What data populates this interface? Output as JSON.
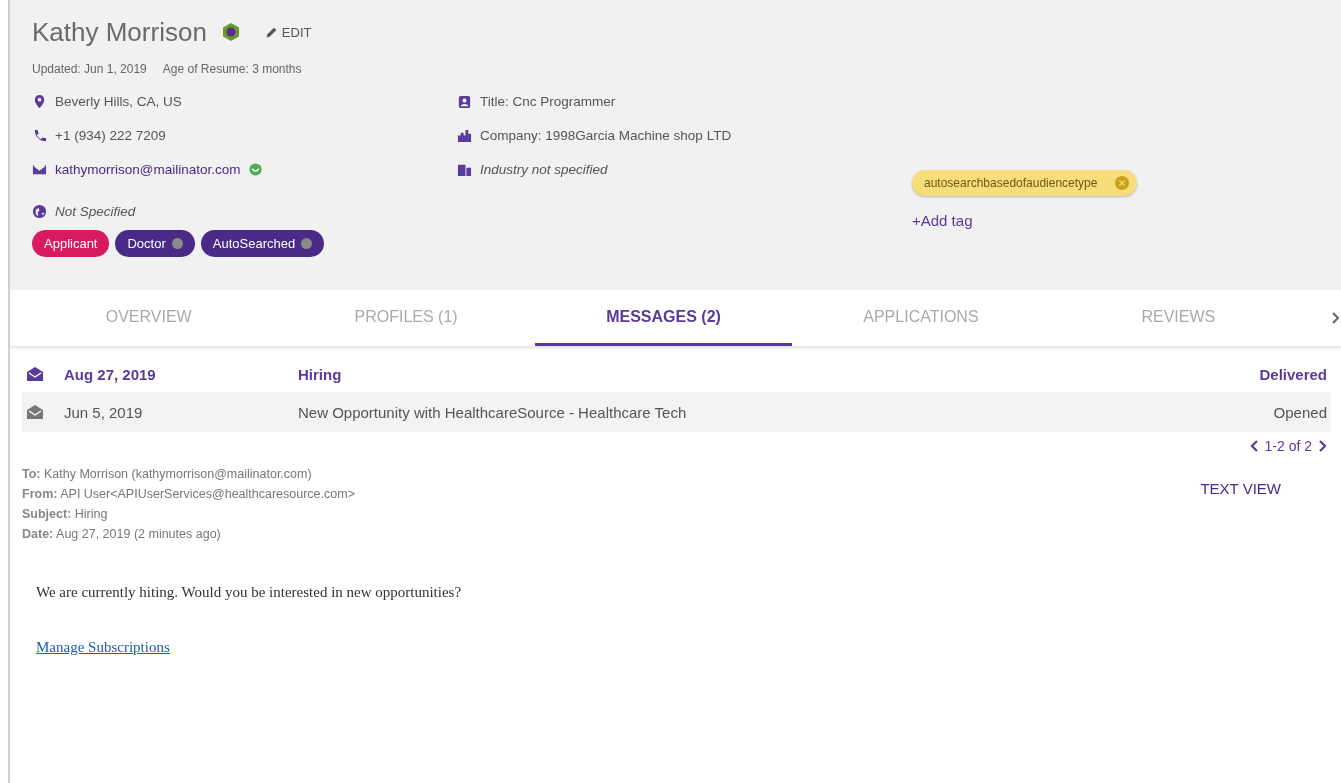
{
  "profile": {
    "name": "Kathy Morrison",
    "edit": "EDIT",
    "updated": "Updated: Jun 1, 2019",
    "resume_age": "Age of Resume: 3 months",
    "contacts": [
      {
        "kind": "location",
        "text": "Beverly Hills, CA, US",
        "italic": false
      },
      {
        "kind": "phone",
        "text": "+1 (934) 222 7209",
        "italic": false
      },
      {
        "kind": "email",
        "text": "kathymorrison@mailinator.com",
        "italic": false,
        "verified": true
      },
      {
        "kind": "web",
        "text": "Not Specified",
        "italic": true
      }
    ],
    "job": [
      {
        "kind": "title",
        "text": "Title: Cnc Programmer",
        "italic": false
      },
      {
        "kind": "company",
        "text": "Company: 1998Garcia Machine shop LTD",
        "italic": false
      },
      {
        "kind": "industry",
        "text": "Industry not specified",
        "italic": true
      }
    ],
    "roles": [
      {
        "label": "Applicant",
        "color": "#d81b60",
        "removable": false
      },
      {
        "label": "Doctor",
        "color": "#4a2a87",
        "removable": true
      },
      {
        "label": "AutoSearched",
        "color": "#4a2a87",
        "removable": true
      }
    ],
    "tags": [
      {
        "label": "autosearchbasedofaudiencetype",
        "color": "#f7dd7c"
      }
    ],
    "add_tag": "+Add tag"
  },
  "tabs": [
    {
      "label": "OVERVIEW",
      "selected": false
    },
    {
      "label": "PROFILES (1)",
      "selected": false
    },
    {
      "label": "MESSAGES (2)",
      "selected": true
    },
    {
      "label": "APPLICATIONS",
      "selected": false
    },
    {
      "label": "REVIEWS",
      "selected": false
    }
  ],
  "messages": [
    {
      "date": "Aug 27, 2019",
      "subject": "Hiring",
      "status": "Delivered",
      "selected": true
    },
    {
      "date": "Jun 5, 2019",
      "subject": "New Opportunity with HealthcareSource - Healthcare Tech",
      "status": "Opened",
      "selected": false
    }
  ],
  "pager": "1-2 of 2",
  "email": {
    "headers": [
      {
        "label": "To:",
        "value": "Kathy Morrison (kathymorrison@mailinator.com)"
      },
      {
        "label": "From:",
        "value": "API User<APIUserServices@healthcaresource.com>"
      },
      {
        "label": "Subject:",
        "value": "Hiring"
      },
      {
        "label": "Date:",
        "value": "Aug 27, 2019 (2 minutes ago)"
      }
    ],
    "text_view": "TEXT VIEW",
    "body": "We are currently hiting. Would you be interested in new opportunities?",
    "link": "Manage Subscriptions"
  }
}
